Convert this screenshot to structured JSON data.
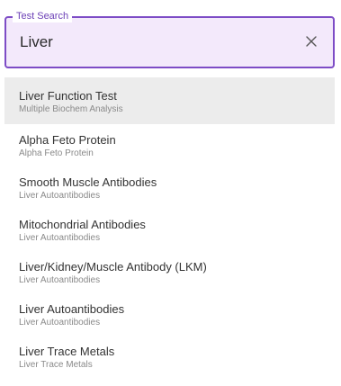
{
  "search": {
    "label": "Test Search",
    "value": "Liver",
    "clear_icon": "close-icon"
  },
  "colors": {
    "accent": "#7d4cc6",
    "field_background": "#f3e9fb",
    "highlight_background": "#ececec"
  },
  "results": [
    {
      "title": "Liver Function Test",
      "subtitle": "Multiple Biochem Analysis",
      "highlighted": true
    },
    {
      "title": "Alpha Feto Protein",
      "subtitle": "Alpha Feto Protein"
    },
    {
      "title": "Smooth Muscle Antibodies",
      "subtitle": "Liver Autoantibodies"
    },
    {
      "title": "Mitochondrial Antibodies",
      "subtitle": "Liver Autoantibodies"
    },
    {
      "title": "Liver/Kidney/Muscle Antibody (LKM)",
      "subtitle": "Liver Autoantibodies"
    },
    {
      "title": "Liver Autoantibodies",
      "subtitle": "Liver Autoantibodies"
    },
    {
      "title": "Liver Trace Metals",
      "subtitle": "Liver Trace Metals"
    }
  ]
}
